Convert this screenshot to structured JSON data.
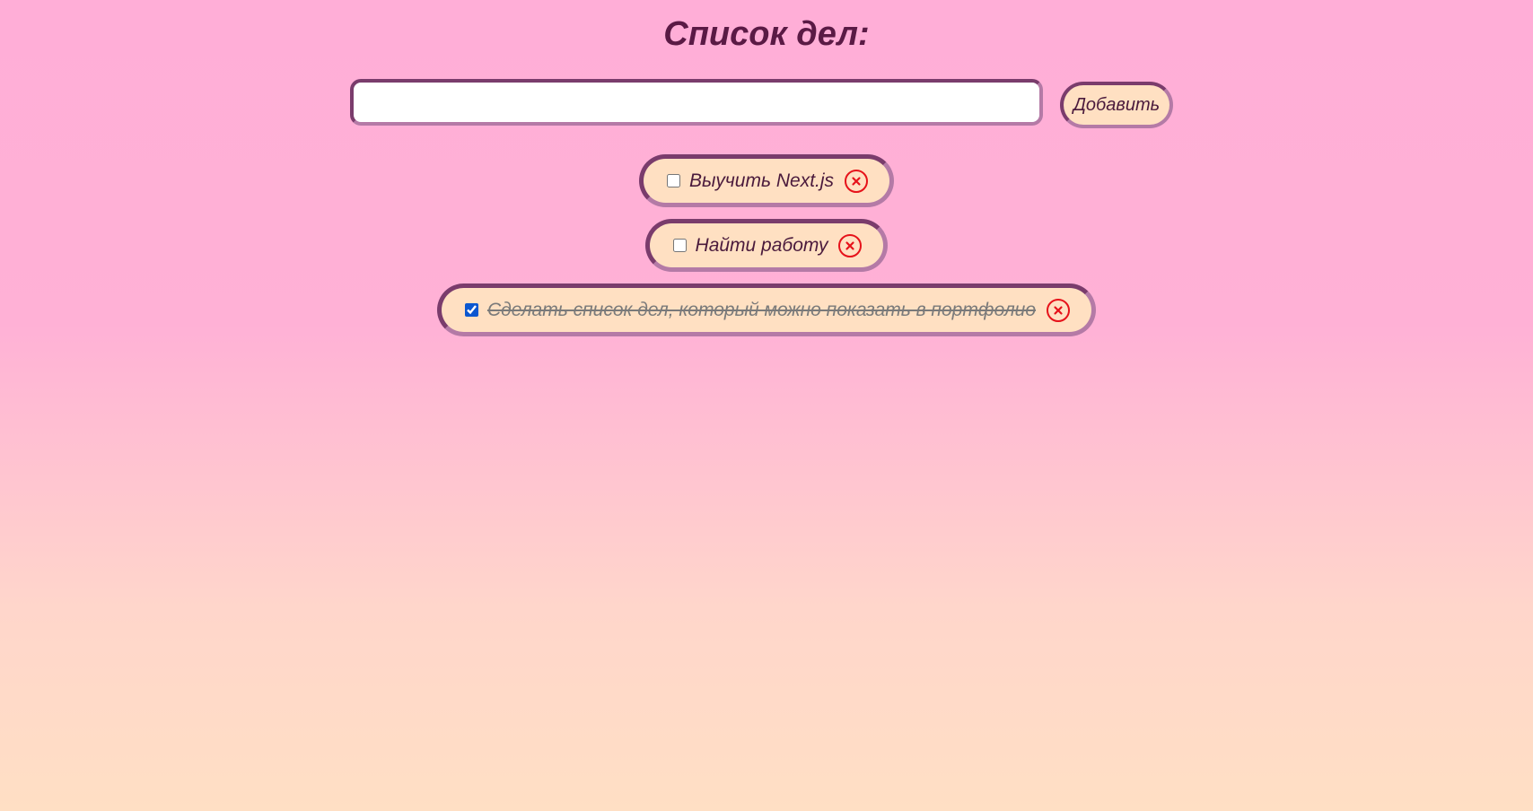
{
  "header": {
    "title": "Список дел:"
  },
  "add_form": {
    "input_value": "",
    "input_placeholder": "",
    "add_label": "Добавить"
  },
  "tasks": [
    {
      "text": "Выучить Next.js",
      "done": false
    },
    {
      "text": "Найти работу",
      "done": false
    },
    {
      "text": "Сделать список дел, который можно показать в портфолио",
      "done": true
    }
  ],
  "colors": {
    "title": "#5a1a45",
    "pill_background": "#ffe0c2",
    "pill_border": "#7a3c6c",
    "delete_icon": "#e6121a",
    "checkbox_accent": "#0b57d0"
  },
  "icons": {
    "delete": "close-circle-icon"
  }
}
